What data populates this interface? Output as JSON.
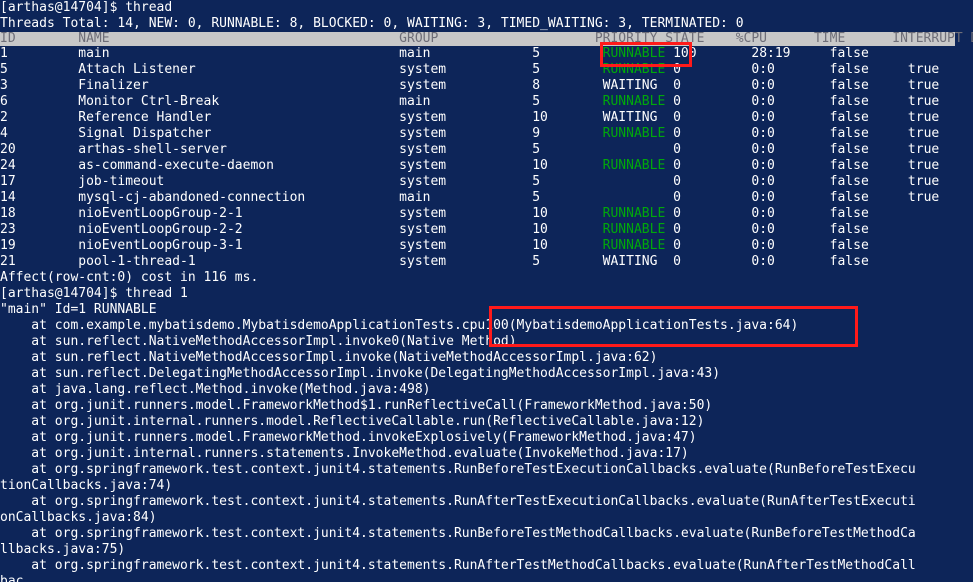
{
  "terminal": {
    "background_color": "#0d2559",
    "text_color": "#ffffff",
    "runnable_color": "#00a80b",
    "header_bg_color": "#c8c8c8",
    "header_text_color": "#6e6e78",
    "annotation_color": "#ff1a1a",
    "prompt": "[arthas@14704]$",
    "command_thread": "[arthas@14704]$ thread",
    "command_thread_1": "[arthas@14704]$ thread 1",
    "summary": "Threads Total: 14, NEW: 0, RUNNABLE: 8, BLOCKED: 0, WAITING: 3, TIMED_WAITING: 3, TERMINATED: 0",
    "affect_line": "Affect(row-cnt:0) cost in 116 ms.",
    "thread_header_line": "\"main\" Id=1 RUNNABLE"
  },
  "table": {
    "header_text": "ID        NAME                                     GROUP                    PRIORITY STATE    %CPU      TIME      INTERRUPT DAEMON",
    "columns": [
      "ID",
      "NAME",
      "GROUP",
      "PRIORITY",
      "STATE",
      "%CPU",
      "TIME",
      "INTERRUPT",
      "DAEMON"
    ],
    "rows": [
      {
        "id": "1",
        "name": "main",
        "group": "main",
        "priority": "5",
        "state": "RUNNABLE",
        "cpu": "100",
        "time": "28:19",
        "interrupt": "false",
        "daemon": ""
      },
      {
        "id": "5",
        "name": "Attach Listener",
        "group": "system",
        "priority": "5",
        "state": "RUNNABLE",
        "cpu": "0",
        "time": "0:0",
        "interrupt": "false",
        "daemon": "true"
      },
      {
        "id": "3",
        "name": "Finalizer",
        "group": "system",
        "priority": "8",
        "state": "WAITING",
        "cpu": "0",
        "time": "0:0",
        "interrupt": "false",
        "daemon": "true"
      },
      {
        "id": "6",
        "name": "Monitor Ctrl-Break",
        "group": "main",
        "priority": "5",
        "state": "RUNNABLE",
        "cpu": "0",
        "time": "0:0",
        "interrupt": "false",
        "daemon": "true"
      },
      {
        "id": "2",
        "name": "Reference Handler",
        "group": "system",
        "priority": "10",
        "state": "WAITING",
        "cpu": "0",
        "time": "0:0",
        "interrupt": "false",
        "daemon": "true"
      },
      {
        "id": "4",
        "name": "Signal Dispatcher",
        "group": "system",
        "priority": "9",
        "state": "RUNNABLE",
        "cpu": "0",
        "time": "0:0",
        "interrupt": "false",
        "daemon": "true"
      },
      {
        "id": "20",
        "name": "arthas-shell-server",
        "group": "system",
        "priority": "5",
        "state": "",
        "cpu": "0",
        "time": "0:0",
        "interrupt": "false",
        "daemon": "true"
      },
      {
        "id": "24",
        "name": "as-command-execute-daemon",
        "group": "system",
        "priority": "10",
        "state": "RUNNABLE",
        "cpu": "0",
        "time": "0:0",
        "interrupt": "false",
        "daemon": "true"
      },
      {
        "id": "17",
        "name": "job-timeout",
        "group": "system",
        "priority": "5",
        "state": "",
        "cpu": "0",
        "time": "0:0",
        "interrupt": "false",
        "daemon": "true"
      },
      {
        "id": "14",
        "name": "mysql-cj-abandoned-connection",
        "group": "main",
        "priority": "5",
        "state": "",
        "cpu": "0",
        "time": "0:0",
        "interrupt": "false",
        "daemon": "true"
      },
      {
        "id": "18",
        "name": "nioEventLoopGroup-2-1",
        "group": "system",
        "priority": "10",
        "state": "RUNNABLE",
        "cpu": "0",
        "time": "0:0",
        "interrupt": "false",
        "daemon": ""
      },
      {
        "id": "23",
        "name": "nioEventLoopGroup-2-2",
        "group": "system",
        "priority": "10",
        "state": "RUNNABLE",
        "cpu": "0",
        "time": "0:0",
        "interrupt": "false",
        "daemon": ""
      },
      {
        "id": "19",
        "name": "nioEventLoopGroup-3-1",
        "group": "system",
        "priority": "10",
        "state": "RUNNABLE",
        "cpu": "0",
        "time": "0:0",
        "interrupt": "false",
        "daemon": ""
      },
      {
        "id": "21",
        "name": "pool-1-thread-1",
        "group": "system",
        "priority": "5",
        "state": "WAITING",
        "cpu": "0",
        "time": "0:0",
        "interrupt": "false",
        "daemon": ""
      }
    ]
  },
  "stack_trace": [
    "    at com.example.mybatisdemo.MybatisdemoApplicationTests.cpu100(MybatisdemoApplicationTests.java:64)",
    "    at sun.reflect.NativeMethodAccessorImpl.invoke0(Native Method)",
    "    at sun.reflect.NativeMethodAccessorImpl.invoke(NativeMethodAccessorImpl.java:62)",
    "    at sun.reflect.DelegatingMethodAccessorImpl.invoke(DelegatingMethodAccessorImpl.java:43)",
    "    at java.lang.reflect.Method.invoke(Method.java:498)",
    "    at org.junit.runners.model.FrameworkMethod$1.runReflectiveCall(FrameworkMethod.java:50)",
    "    at org.junit.internal.runners.model.ReflectiveCallable.run(ReflectiveCallable.java:12)",
    "    at org.junit.runners.model.FrameworkMethod.invokeExplosively(FrameworkMethod.java:47)",
    "    at org.junit.internal.runners.statements.InvokeMethod.evaluate(InvokeMethod.java:17)",
    "    at org.springframework.test.context.junit4.statements.RunBeforeTestExecutionCallbacks.evaluate(RunBeforeTestExecutionCallbacks.java:74)",
    "    at org.springframework.test.context.junit4.statements.RunAfterTestExecutionCallbacks.evaluate(RunAfterTestExecutionCallbacks.java:84)",
    "    at org.springframework.test.context.junit4.statements.RunBeforeTestMethodCallbacks.evaluate(RunBeforeTestMethodCallbacks.java:75)",
    "    at org.springframework.test.context.junit4.statements.RunAfterTestMethodCallbacks.evaluate(RunAfterTestMethodCallbac"
  ],
  "annotations": [
    {
      "name": "cpu-highlight-box",
      "target": "100"
    },
    {
      "name": "stack-frame-highlight-box",
      "target": "cpu100(MybatisdemoApplicationTests.java:64)"
    }
  ]
}
